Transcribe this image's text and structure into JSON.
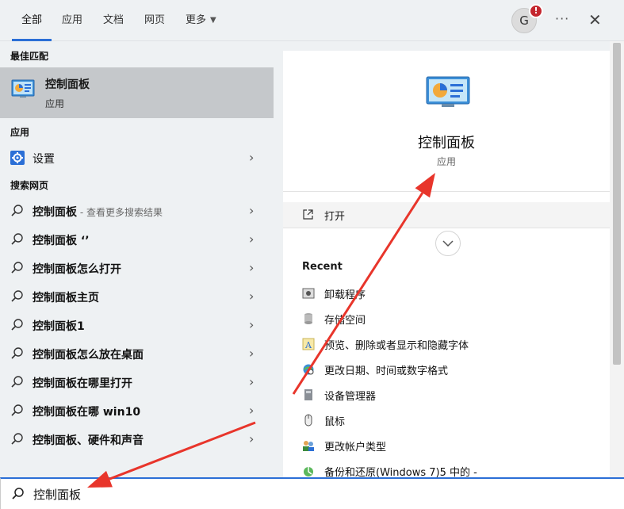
{
  "tabs": [
    {
      "label": "全部",
      "active": true
    },
    {
      "label": "应用"
    },
    {
      "label": "文档"
    },
    {
      "label": "网页"
    },
    {
      "label": "更多"
    }
  ],
  "account": {
    "initial": "G",
    "alert": "!"
  },
  "toolbar": {
    "more": "···",
    "close": "✕"
  },
  "left": {
    "best_match_heading": "最佳匹配",
    "best_match": {
      "title": "控制面板",
      "subtitle": "应用"
    },
    "apps_heading": "应用",
    "apps": [
      {
        "label": "设置"
      }
    ],
    "web_heading": "搜索网页",
    "web_results": [
      {
        "label": "控制面板",
        "suffix": " - 查看更多搜索结果"
      },
      {
        "label": "控制面板 ‘’"
      },
      {
        "label": "控制面板怎么打开"
      },
      {
        "label": "控制面板主页"
      },
      {
        "label": "控制面板1"
      },
      {
        "label": "控制面板怎么放在桌面"
      },
      {
        "label": "控制面板在哪里打开"
      },
      {
        "label": "控制面板在哪 win10"
      },
      {
        "label": "控制面板、硬件和声音"
      }
    ]
  },
  "right": {
    "app_name": "控制面板",
    "app_type": "应用",
    "open_label": "打开",
    "recent_heading": "Recent",
    "recent": [
      {
        "label": "卸载程序"
      },
      {
        "label": "存储空间"
      },
      {
        "label": "预览、删除或者显示和隐藏字体"
      },
      {
        "label": "更改日期、时间或数字格式"
      },
      {
        "label": "设备管理器"
      },
      {
        "label": "鼠标"
      },
      {
        "label": "更改帐户类型"
      },
      {
        "label": "备份和还原(Windows 7)5 中的 -"
      }
    ]
  },
  "search": {
    "value": "控制面板"
  },
  "colors": {
    "accent": "#2b6fd6",
    "arrow": "#e8352b",
    "alert": "#c4262e"
  }
}
